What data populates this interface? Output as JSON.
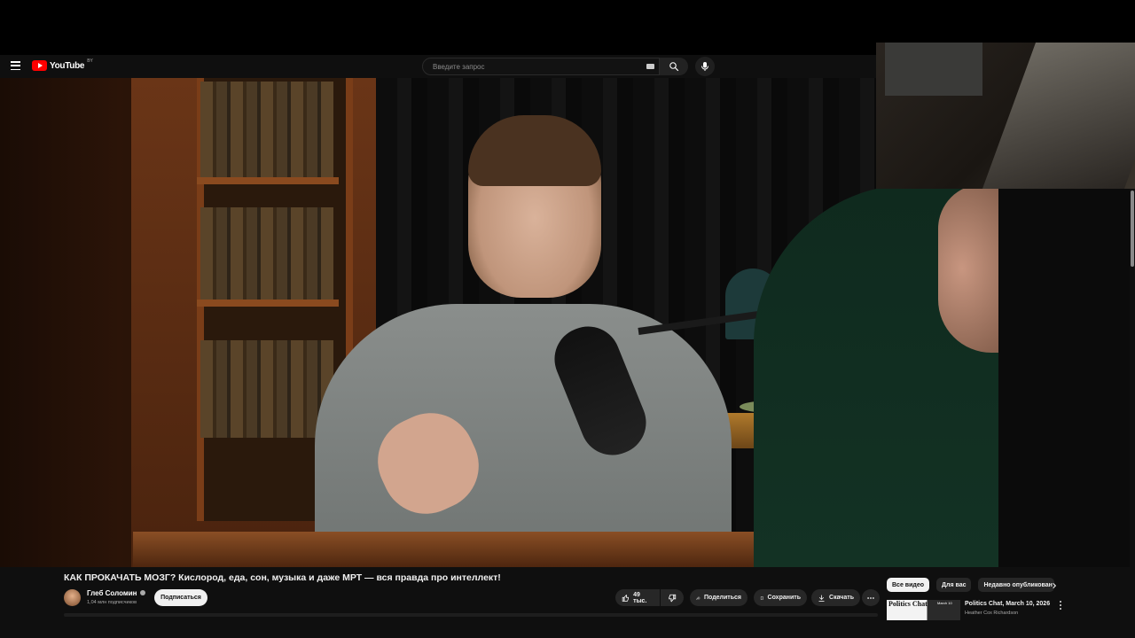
{
  "header": {
    "logo_text": "YouTube",
    "region": "BY",
    "search_placeholder": "Введите запрос"
  },
  "video": {
    "title": "КАК ПРОКАЧАТЬ МОЗГ? Кислород, еда, сон, музыка и даже МРТ — вся правда про интеллект!",
    "channel": {
      "name": "Глеб Соломин",
      "subscribers": "1,04 млн подписчиков",
      "subscribe_label": "Подписаться"
    },
    "actions": {
      "likes": "49 тыс.",
      "share": "Поделиться",
      "save": "Сохранить",
      "download": "Скачать"
    }
  },
  "sidebar": {
    "chips": [
      "Все видео",
      "Для вас",
      "Недавно опубликован"
    ],
    "recommendation": {
      "thumb_title": "Politics Chat",
      "thumb_date": "March 10",
      "title": "Politics Chat, March 10, 2026",
      "channel": "Heather Cox Richardson"
    }
  },
  "colors": {
    "brand_red": "#ff0000",
    "background": "#0f0f0f",
    "chip_active": "#f1f1f1"
  },
  "icons": [
    "menu-icon",
    "youtube-logo-icon",
    "keyboard-icon",
    "search-icon",
    "mic-icon",
    "like-icon",
    "dislike-icon",
    "share-icon",
    "save-icon",
    "download-icon",
    "more-icon",
    "chevron-right-icon",
    "verified-icon"
  ]
}
